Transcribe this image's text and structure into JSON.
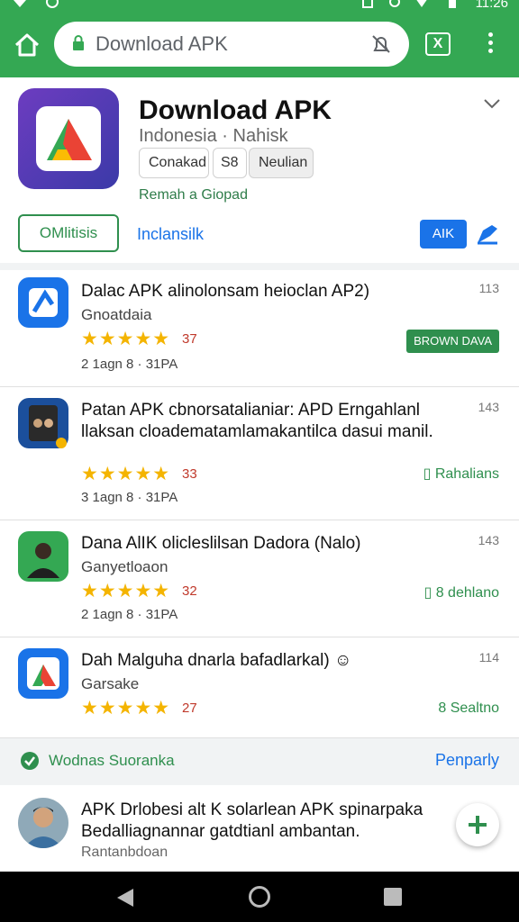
{
  "status": {
    "time": "11:26"
  },
  "browser": {
    "omnibox_text": "Download APK",
    "tab_count": "X"
  },
  "app": {
    "title": "Download APK",
    "subtitle": "Indonesia · Nahisk",
    "chips": [
      "Conakad",
      "S8",
      "Neulian"
    ],
    "developer": "Remah a Giopad",
    "outline_button": "OMlitisis",
    "install_link": "Inclansilk",
    "blue_button": "AIK",
    "colors": {
      "brand_green": "#34a853",
      "blue": "#1a73e8",
      "star": "#f4b400"
    }
  },
  "list": [
    {
      "title": "Dalac APK alinolonsam heioclan AP2)",
      "subtitle": "Gnoatdaia",
      "num": "113",
      "stars": "★★★★★",
      "rating": "37",
      "meta": "2 1agn  8 · 31PA",
      "action": "BROWN DAVA",
      "icon": "blue-app-icon"
    },
    {
      "title": "Patan APK cbnorsatalianiar: APD Erngahlanl llaksan cloadematamlamakantilca dasui manil.",
      "subtitle": "",
      "num": "143",
      "stars": "★★★★★",
      "rating": "33",
      "meta": "3 1agn  8 · 31PA",
      "action": "Rahalians",
      "icon": "photo-app-icon"
    },
    {
      "title": "Dana AlIK olicleslilsan Dadora (Nalo)",
      "subtitle": "Ganyetloaon",
      "num": "143",
      "stars": "★★★★★",
      "rating": "32",
      "meta": "2 1agn  8 · 31PA",
      "action": "8 dehlano",
      "icon": "person-app-icon"
    },
    {
      "title": "Dah Malguha dnarla bafadlarkal) ☺",
      "subtitle": "Garsake",
      "num": "114",
      "stars": "★★★★★",
      "rating": "27",
      "meta": "",
      "action": "8 Sealtno",
      "icon": "logo-app-icon"
    }
  ],
  "verified": {
    "text": "Wodnas Suoranka",
    "link": "Penparly"
  },
  "comment": {
    "text": "APK Drlobesi alt K solarlean APK spinarpaka Bedalliagnannar gatdtianl ambantan.",
    "author": "Rantanbdoan"
  }
}
